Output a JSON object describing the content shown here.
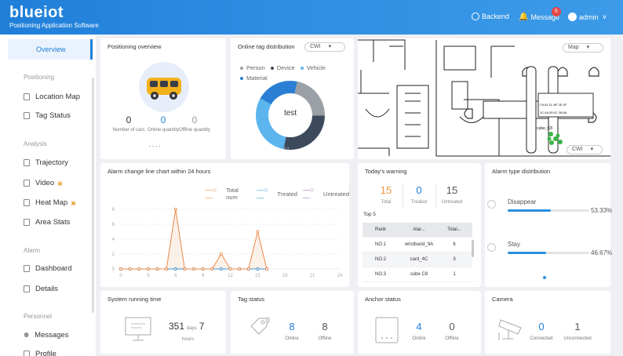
{
  "header": {
    "brand": "blueiot",
    "subtitle": "Positioning Application Software",
    "backend": "Backend",
    "message": "Message",
    "message_badge": "6",
    "user": "admin"
  },
  "sidebar": {
    "active": "Overview",
    "sections": [
      {
        "title": "Positioning",
        "items": [
          "Location Map",
          "Tag Status"
        ]
      },
      {
        "title": "Analysis",
        "items": [
          "Trajectory",
          "Video",
          "Heat Map",
          "Area Stats"
        ]
      },
      {
        "title": "Alarm",
        "items": [
          "Dashboard",
          "Details"
        ]
      },
      {
        "title": "Personnel",
        "items": [
          "Messages",
          "Profile"
        ]
      }
    ]
  },
  "positioning_overview": {
    "title": "Positioning overview",
    "stats": [
      {
        "value": "0",
        "label": "Number of cars"
      },
      {
        "value": "0",
        "label": "Online quantity"
      },
      {
        "value": "0",
        "label": "Offline quantity"
      }
    ]
  },
  "online_tag": {
    "title": "Online tag distribution",
    "select": "CWI",
    "legend": [
      "Person",
      "Device",
      "Vehicle",
      "Material"
    ],
    "legend_colors": [
      "#9aa0a6",
      "#3d4a5c",
      "#5cb5ef",
      "#2a7fd4"
    ],
    "center_label": "test",
    "slices": [
      {
        "name": "Person",
        "value": 22,
        "color": "#9aa0a6"
      },
      {
        "name": "Device",
        "value": 28,
        "color": "#3d4a5c"
      },
      {
        "name": "Vehicle",
        "value": 30,
        "color": "#5cb5ef"
      },
      {
        "name": "Material",
        "value": 20,
        "color": "#2a7fd4"
      }
    ]
  },
  "map": {
    "select": "Map",
    "select2": "CWI",
    "label_cube": "cube_C8"
  },
  "alarm_chart": {
    "title": "Alarm change line chart within 24 hours",
    "legend": [
      "Total num",
      "Treated",
      "Untreated"
    ],
    "legend_colors": [
      "#e8894a",
      "#3a9ad9",
      "#9b6fc6"
    ],
    "chart_data": {
      "type": "line",
      "x": [
        0,
        1,
        2,
        3,
        4,
        5,
        6,
        7,
        8,
        9,
        10,
        11,
        12,
        13,
        14,
        15,
        16
      ],
      "series": [
        {
          "name": "Total num",
          "values": [
            0,
            0,
            0,
            0,
            0,
            0,
            8,
            0,
            0,
            0,
            0,
            2,
            0,
            0,
            0,
            5,
            0
          ]
        },
        {
          "name": "Treated",
          "values": [
            0,
            0,
            0,
            0,
            0,
            0,
            0,
            0,
            0,
            0,
            0,
            0,
            0,
            0,
            0,
            0,
            0
          ]
        },
        {
          "name": "Untreated",
          "values": [
            0,
            0,
            0,
            0,
            0,
            0,
            0,
            0,
            0,
            0,
            0,
            0,
            0,
            0,
            0,
            0,
            0
          ]
        }
      ],
      "xticks": [
        "0",
        "3",
        "6",
        "9",
        "12",
        "15",
        "18",
        "21",
        "24"
      ],
      "yticks": [
        "0",
        "2",
        "4",
        "6",
        "8"
      ],
      "xlim": [
        0,
        24
      ],
      "ylim": [
        0,
        8
      ]
    }
  },
  "todays_warning": {
    "title": "Today's warning",
    "total": "15",
    "total_label": "Total",
    "treated": "0",
    "treated_label": "Treated",
    "untreated": "15",
    "untreated_label": "Untreated",
    "top_label": "Top 5",
    "columns": [
      "Rank",
      "Alar...",
      "Total..."
    ],
    "rows": [
      [
        "NO.1",
        "wristband_9A",
        "6"
      ],
      [
        "NO.2",
        "card_4C",
        "3"
      ],
      [
        "NO.3",
        "cube C8",
        "1"
      ]
    ]
  },
  "alarm_type": {
    "title": "Alarm type distribution",
    "items": [
      {
        "label": "Disappear",
        "pct": "53.33",
        "fraction": 0.5333
      },
      {
        "label": "Stay",
        "pct": "46.67",
        "fraction": 0.4667
      }
    ]
  },
  "system_running": {
    "title": "System running time",
    "days": "351",
    "days_unit": "days",
    "hours": "7",
    "hours_unit": "hours"
  },
  "tag_status": {
    "title": "Tag status",
    "online": "8",
    "online_label": "Online",
    "offline": "8",
    "offline_label": "Offline"
  },
  "anchor_status": {
    "title": "Anchor status",
    "online": "4",
    "online_label": "Online",
    "offline": "0",
    "offline_label": "Offline"
  },
  "camera": {
    "title": "Camera",
    "connected": "0",
    "connected_label": "Connected",
    "unconnected": "1",
    "unconnected_label": "Unconnected"
  }
}
